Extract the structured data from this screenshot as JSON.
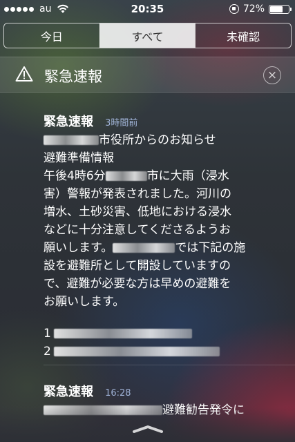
{
  "status_bar": {
    "carrier": "au",
    "time": "20:35",
    "battery_percent": "72%",
    "battery_level": 0.72,
    "signal_dots": 5
  },
  "tabs": [
    {
      "label": "今日",
      "active": false
    },
    {
      "label": "すべて",
      "active": true
    },
    {
      "label": "未確認",
      "active": false
    }
  ],
  "section": {
    "title": "緊急速報",
    "close_symbol": "×"
  },
  "notifications": [
    {
      "title": "緊急速報",
      "time": "3時間前",
      "line1_suffix": "市役所からのお知らせ",
      "line2": "避難準備情報",
      "line3_prefix": "午後4時6分",
      "line3_suffix": "市に大雨（浸水",
      "line4": "害）警報が発表されました。河川の",
      "line5": "増水、土砂災害、低地における浸水",
      "line6": "などに十分注意してくださるようお",
      "line7_prefix": "願いします。",
      "line7_suffix": "では下記の施",
      "line8": "設を避難所として開設していますの",
      "line9": "で、避難が必要な方は早めの避難を",
      "line10": "お願いします。",
      "item1_number": "1",
      "item2_number": "2"
    },
    {
      "title": "緊急速報",
      "time": "16:28",
      "line1_suffix": "避難勧告発令に"
    }
  ],
  "colors": {
    "timestamp": "#9fb2d6",
    "segment_active_bg": "#d9d9d9"
  }
}
